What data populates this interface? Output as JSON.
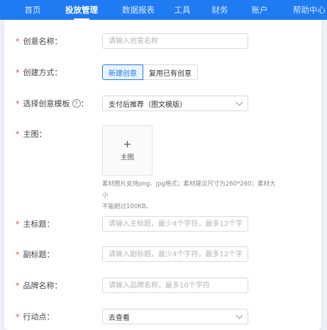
{
  "nav": {
    "items": [
      {
        "label": "首页",
        "active": false
      },
      {
        "label": "投放管理",
        "active": true
      },
      {
        "label": "数据报表",
        "active": false
      },
      {
        "label": "工具",
        "active": false
      },
      {
        "label": "财务",
        "active": false
      },
      {
        "label": "账户",
        "active": false
      },
      {
        "label": "帮助中心",
        "active": false
      }
    ]
  },
  "form": {
    "creative_name": {
      "label": "创意名称：",
      "placeholder": "请输入创意名称"
    },
    "create_method": {
      "label": "创建方式：",
      "options": [
        "新建创意",
        "复用已有创意"
      ],
      "selected": "新建创意"
    },
    "template": {
      "label": "选择创意模板",
      "label_suffix": "：",
      "help": "?",
      "value": "支付后推荐（图文模版）"
    },
    "main_image": {
      "label": "主图：",
      "upload_plus": "+",
      "upload_text": "主图",
      "hint_line1": "素材图片支持png、jpg格式；素材建议尺寸为260*260；素材大小",
      "hint_line2": "不能超过100KB。"
    },
    "main_title": {
      "label": "主标题：",
      "placeholder": "请输入主标题，最少4个字符，最多12个字..."
    },
    "sub_title": {
      "label": "副标题：",
      "placeholder": "请输入副标题，最少4个字符，最多12个字..."
    },
    "brand_name": {
      "label": "品牌名称：",
      "placeholder": "请输入品牌名称，最多10个字符"
    },
    "action": {
      "label": "行动点：",
      "value": "去查看"
    }
  },
  "required_mark": "*",
  "colors": {
    "primary": "#1f7bf2",
    "required": "#e8453c"
  }
}
